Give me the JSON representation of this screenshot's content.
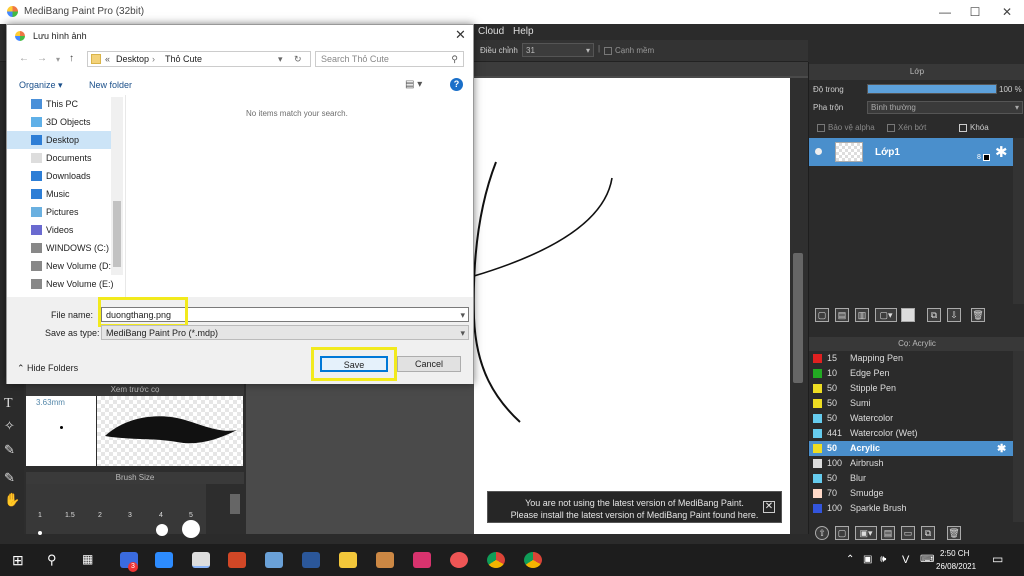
{
  "app": {
    "title": "MediBang Paint Pro (32bit)",
    "menu": [
      "Cloud",
      "Help"
    ],
    "tool_options": {
      "adjust_label": "Điều chỉnh",
      "adjust_value": "31",
      "antialias_label": "Cạnh mềm"
    }
  },
  "dialog": {
    "title": "Lưu hình ảnh",
    "breadcrumb": [
      "«",
      "Desktop",
      "›",
      "Thỏ Cute"
    ],
    "search_placeholder": "Search Thỏ Cute",
    "organize": "Organize ▾",
    "new_folder": "New folder",
    "empty_message": "No items match your search.",
    "tree": [
      {
        "label": "This PC",
        "icon": "computer-icon"
      },
      {
        "label": "3D Objects",
        "icon": "cube-icon"
      },
      {
        "label": "Desktop",
        "icon": "desktop-icon"
      },
      {
        "label": "Documents",
        "icon": "document-icon"
      },
      {
        "label": "Downloads",
        "icon": "download-icon"
      },
      {
        "label": "Music",
        "icon": "music-icon"
      },
      {
        "label": "Pictures",
        "icon": "picture-icon"
      },
      {
        "label": "Videos",
        "icon": "video-icon"
      },
      {
        "label": "WINDOWS (C:)",
        "icon": "drive-icon"
      },
      {
        "label": "New Volume (D:",
        "icon": "drive-icon"
      },
      {
        "label": "New Volume (E:)",
        "icon": "drive-icon"
      }
    ],
    "selected_folder": "Desktop",
    "file_name_label": "File name:",
    "file_name_value": "duongthang.png",
    "save_type_label": "Save as type:",
    "save_type_value": "MediBang Paint Pro (*.mdp)",
    "hide_folders": "Hide Folders",
    "save": "Save",
    "cancel": "Cancel"
  },
  "left_panels": {
    "brush_preview_title": "Xem trước cọ",
    "brush_size_readout": "3.63mm",
    "brush_size_title": "Brush Size",
    "size_labels": [
      "1",
      "1.5",
      "2",
      "3",
      "4",
      "5"
    ]
  },
  "layer_panel": {
    "title": "Lớp",
    "opacity_label": "Độ trong",
    "opacity_value": "100 %",
    "opacity": 1.0,
    "blend_label": "Pha trộn",
    "blend_value": "Bình thường",
    "protect_alpha": "Bảo vệ alpha",
    "clipping": "Xén bớt",
    "lock": "Khóa",
    "layer_name": "Lớp1",
    "layer_bits": "8"
  },
  "brush_panel": {
    "title": "Cọ: Acrylic",
    "selected": "Acrylic",
    "items": [
      {
        "size": "15",
        "name": "Mapping Pen",
        "color": "#e02020"
      },
      {
        "size": "10",
        "name": "Edge Pen",
        "color": "#22aa22"
      },
      {
        "size": "50",
        "name": "Stipple Pen",
        "color": "#eedd22"
      },
      {
        "size": "50",
        "name": "Sumi",
        "color": "#eedd22"
      },
      {
        "size": "50",
        "name": "Watercolor",
        "color": "#66ccee"
      },
      {
        "size": "441",
        "name": "Watercolor (Wet)",
        "color": "#66ccee"
      },
      {
        "size": "50",
        "name": "Acrylic",
        "color": "#eedd22"
      },
      {
        "size": "100",
        "name": "Airbrush",
        "color": "#dddddd"
      },
      {
        "size": "50",
        "name": "Blur",
        "color": "#66ccee"
      },
      {
        "size": "70",
        "name": "Smudge",
        "color": "#ffd9c8"
      },
      {
        "size": "100",
        "name": "Sparkle Brush",
        "color": "#3355dd"
      }
    ]
  },
  "notification": {
    "line1": "You are not using the latest version of MediBang Paint.",
    "line2": "Please install the latest version of MediBang Paint found here."
  },
  "taskbar": {
    "time": "2:50 CH",
    "date": "26/08/2021",
    "lang": "V",
    "badge": "3"
  },
  "colors": {
    "accent": "#4a8fcc",
    "highlight": "#f2ea1c"
  }
}
